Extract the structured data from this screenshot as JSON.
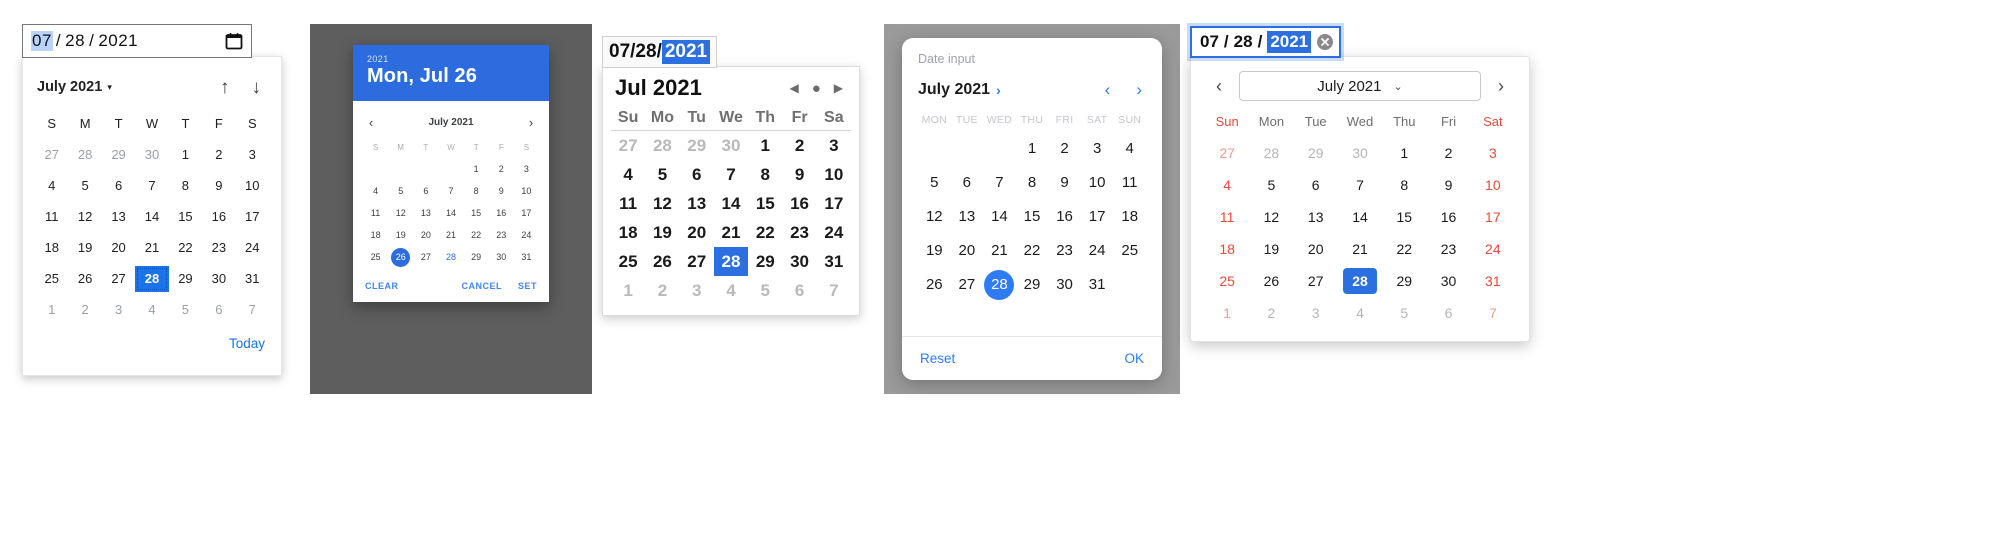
{
  "panel1": {
    "name": "chrome-native-date-picker",
    "input": {
      "month": "07",
      "day": "28",
      "year": "2021",
      "slash": "/",
      "selected_segment": "month"
    },
    "icon": "calendar-icon",
    "month_label": "July 2021",
    "caret": "▾",
    "prev_arrow": "↑",
    "next_arrow": "↓",
    "dow": [
      "S",
      "M",
      "T",
      "W",
      "T",
      "F",
      "S"
    ],
    "weeks": [
      [
        {
          "d": "27",
          "mute": true
        },
        {
          "d": "28",
          "mute": true
        },
        {
          "d": "29",
          "mute": true
        },
        {
          "d": "30",
          "mute": true
        },
        {
          "d": "1"
        },
        {
          "d": "2"
        },
        {
          "d": "3"
        }
      ],
      [
        {
          "d": "4"
        },
        {
          "d": "5"
        },
        {
          "d": "6"
        },
        {
          "d": "7"
        },
        {
          "d": "8"
        },
        {
          "d": "9"
        },
        {
          "d": "10"
        }
      ],
      [
        {
          "d": "11"
        },
        {
          "d": "12"
        },
        {
          "d": "13"
        },
        {
          "d": "14"
        },
        {
          "d": "15"
        },
        {
          "d": "16"
        },
        {
          "d": "17"
        }
      ],
      [
        {
          "d": "18"
        },
        {
          "d": "19"
        },
        {
          "d": "20"
        },
        {
          "d": "21"
        },
        {
          "d": "22"
        },
        {
          "d": "23"
        },
        {
          "d": "24"
        }
      ],
      [
        {
          "d": "25"
        },
        {
          "d": "26"
        },
        {
          "d": "27"
        },
        {
          "d": "28",
          "sel": true
        },
        {
          "d": "29"
        },
        {
          "d": "30"
        },
        {
          "d": "31"
        }
      ],
      [
        {
          "d": "1",
          "mute": true
        },
        {
          "d": "2",
          "mute": true
        },
        {
          "d": "3",
          "mute": true
        },
        {
          "d": "4",
          "mute": true
        },
        {
          "d": "5",
          "mute": true
        },
        {
          "d": "6",
          "mute": true
        },
        {
          "d": "7",
          "mute": true
        }
      ]
    ],
    "today_label": "Today",
    "accent": "#1a73e8"
  },
  "panel2": {
    "name": "material-date-picker-dialog",
    "header_year": "2021",
    "header_date": "Mon, Jul 26",
    "prev_arrow": "‹",
    "next_arrow": "›",
    "month_label": "July 2021",
    "dow": [
      "S",
      "M",
      "T",
      "W",
      "T",
      "F",
      "S"
    ],
    "weeks": [
      [
        {
          "d": ""
        },
        {
          "d": ""
        },
        {
          "d": ""
        },
        {
          "d": ""
        },
        {
          "d": "1"
        },
        {
          "d": "2"
        },
        {
          "d": "3"
        }
      ],
      [
        {
          "d": "4"
        },
        {
          "d": "5"
        },
        {
          "d": "6"
        },
        {
          "d": "7"
        },
        {
          "d": "8"
        },
        {
          "d": "9"
        },
        {
          "d": "10"
        }
      ],
      [
        {
          "d": "11"
        },
        {
          "d": "12"
        },
        {
          "d": "13"
        },
        {
          "d": "14"
        },
        {
          "d": "15"
        },
        {
          "d": "16"
        },
        {
          "d": "17"
        }
      ],
      [
        {
          "d": "18"
        },
        {
          "d": "19"
        },
        {
          "d": "20"
        },
        {
          "d": "21"
        },
        {
          "d": "22"
        },
        {
          "d": "23"
        },
        {
          "d": "24"
        }
      ],
      [
        {
          "d": "25"
        },
        {
          "d": "26",
          "sel": true
        },
        {
          "d": "27"
        },
        {
          "d": "28",
          "today": true
        },
        {
          "d": "29"
        },
        {
          "d": "30"
        },
        {
          "d": "31"
        }
      ]
    ],
    "clear_label": "CLEAR",
    "cancel_label": "CANCEL",
    "set_label": "SET",
    "accent": "#2d6cdf",
    "scrim": "#5e5e5e"
  },
  "panel3": {
    "name": "firefox-classic-date-picker",
    "input": {
      "month": "07",
      "day": "28",
      "year": "2021",
      "slash": "/",
      "selected_segment": "year"
    },
    "month_label": "Jul 2021",
    "prev_arrow": "◀",
    "dot": "●",
    "next_arrow": "▶",
    "dow": [
      "Su",
      "Mo",
      "Tu",
      "We",
      "Th",
      "Fr",
      "Sa"
    ],
    "weeks": [
      [
        {
          "d": "27",
          "mute": true
        },
        {
          "d": "28",
          "mute": true
        },
        {
          "d": "29",
          "mute": true
        },
        {
          "d": "30",
          "mute": true
        },
        {
          "d": "1"
        },
        {
          "d": "2"
        },
        {
          "d": "3"
        }
      ],
      [
        {
          "d": "4"
        },
        {
          "d": "5"
        },
        {
          "d": "6"
        },
        {
          "d": "7"
        },
        {
          "d": "8"
        },
        {
          "d": "9"
        },
        {
          "d": "10"
        }
      ],
      [
        {
          "d": "11"
        },
        {
          "d": "12"
        },
        {
          "d": "13"
        },
        {
          "d": "14"
        },
        {
          "d": "15"
        },
        {
          "d": "16"
        },
        {
          "d": "17"
        }
      ],
      [
        {
          "d": "18"
        },
        {
          "d": "19"
        },
        {
          "d": "20"
        },
        {
          "d": "21"
        },
        {
          "d": "22"
        },
        {
          "d": "23"
        },
        {
          "d": "24"
        }
      ],
      [
        {
          "d": "25"
        },
        {
          "d": "26"
        },
        {
          "d": "27"
        },
        {
          "d": "28",
          "sel": true
        },
        {
          "d": "29"
        },
        {
          "d": "30"
        },
        {
          "d": "31"
        }
      ],
      [
        {
          "d": "1",
          "mute": true
        },
        {
          "d": "2",
          "mute": true
        },
        {
          "d": "3",
          "mute": true
        },
        {
          "d": "4",
          "mute": true
        },
        {
          "d": "5",
          "mute": true
        },
        {
          "d": "6",
          "mute": true
        },
        {
          "d": "7",
          "mute": true
        }
      ]
    ],
    "accent": "#2b6fe0"
  },
  "panel4": {
    "name": "ios-date-input-sheet",
    "field_label": "Date input",
    "month_label": "July 2021",
    "month_chevron": "›",
    "prev_arrow": "‹",
    "next_arrow": "›",
    "dow": [
      "MON",
      "TUE",
      "WED",
      "THU",
      "FRI",
      "SAT",
      "SUN"
    ],
    "weeks": [
      [
        {
          "d": ""
        },
        {
          "d": ""
        },
        {
          "d": ""
        },
        {
          "d": "1"
        },
        {
          "d": "2"
        },
        {
          "d": "3"
        },
        {
          "d": "4"
        }
      ],
      [
        {
          "d": "5"
        },
        {
          "d": "6"
        },
        {
          "d": "7"
        },
        {
          "d": "8"
        },
        {
          "d": "9"
        },
        {
          "d": "10"
        },
        {
          "d": "11"
        }
      ],
      [
        {
          "d": "12"
        },
        {
          "d": "13"
        },
        {
          "d": "14"
        },
        {
          "d": "15"
        },
        {
          "d": "16"
        },
        {
          "d": "17"
        },
        {
          "d": "18"
        }
      ],
      [
        {
          "d": "19"
        },
        {
          "d": "20"
        },
        {
          "d": "21"
        },
        {
          "d": "22"
        },
        {
          "d": "23"
        },
        {
          "d": "24"
        },
        {
          "d": "25"
        }
      ],
      [
        {
          "d": "26"
        },
        {
          "d": "27"
        },
        {
          "d": "28",
          "sel": true
        },
        {
          "d": "29"
        },
        {
          "d": "30"
        },
        {
          "d": "31"
        },
        {
          "d": ""
        }
      ]
    ],
    "reset_label": "Reset",
    "ok_label": "OK",
    "accent": "#2d7cf6",
    "scrim": "#9a9a9a"
  },
  "panel5": {
    "name": "firefox-modern-date-picker",
    "input": {
      "month": "07",
      "day": "28",
      "year": "2021",
      "slash": "/",
      "selected_segment": "year"
    },
    "clear_icon": "clear-circle-icon",
    "prev_arrow": "‹",
    "next_arrow": "›",
    "month_label": "July 2021",
    "month_chevron": "⌄",
    "dow": [
      {
        "l": "Sun",
        "red": true
      },
      {
        "l": "Mon"
      },
      {
        "l": "Tue"
      },
      {
        "l": "Wed"
      },
      {
        "l": "Thu"
      },
      {
        "l": "Fri"
      },
      {
        "l": "Sat",
        "red": true
      }
    ],
    "weeks": [
      [
        {
          "d": "27",
          "mute": true,
          "red": true
        },
        {
          "d": "28",
          "mute": true
        },
        {
          "d": "29",
          "mute": true
        },
        {
          "d": "30",
          "mute": true
        },
        {
          "d": "1"
        },
        {
          "d": "2"
        },
        {
          "d": "3",
          "red": true
        }
      ],
      [
        {
          "d": "4",
          "red": true
        },
        {
          "d": "5"
        },
        {
          "d": "6"
        },
        {
          "d": "7"
        },
        {
          "d": "8"
        },
        {
          "d": "9"
        },
        {
          "d": "10",
          "red": true
        }
      ],
      [
        {
          "d": "11",
          "red": true
        },
        {
          "d": "12"
        },
        {
          "d": "13"
        },
        {
          "d": "14"
        },
        {
          "d": "15"
        },
        {
          "d": "16"
        },
        {
          "d": "17",
          "red": true
        }
      ],
      [
        {
          "d": "18",
          "red": true
        },
        {
          "d": "19"
        },
        {
          "d": "20"
        },
        {
          "d": "21"
        },
        {
          "d": "22"
        },
        {
          "d": "23"
        },
        {
          "d": "24",
          "red": true
        }
      ],
      [
        {
          "d": "25",
          "red": true
        },
        {
          "d": "26"
        },
        {
          "d": "27"
        },
        {
          "d": "28",
          "sel": true
        },
        {
          "d": "29"
        },
        {
          "d": "30"
        },
        {
          "d": "31",
          "red": true
        }
      ],
      [
        {
          "d": "1",
          "mute": true,
          "red": true
        },
        {
          "d": "2",
          "mute": true
        },
        {
          "d": "3",
          "mute": true
        },
        {
          "d": "4",
          "mute": true
        },
        {
          "d": "5",
          "mute": true
        },
        {
          "d": "6",
          "mute": true
        },
        {
          "d": "7",
          "mute": true,
          "red": true
        }
      ]
    ],
    "accent": "#2b6fe0",
    "weekend_color": "#e8493a"
  }
}
